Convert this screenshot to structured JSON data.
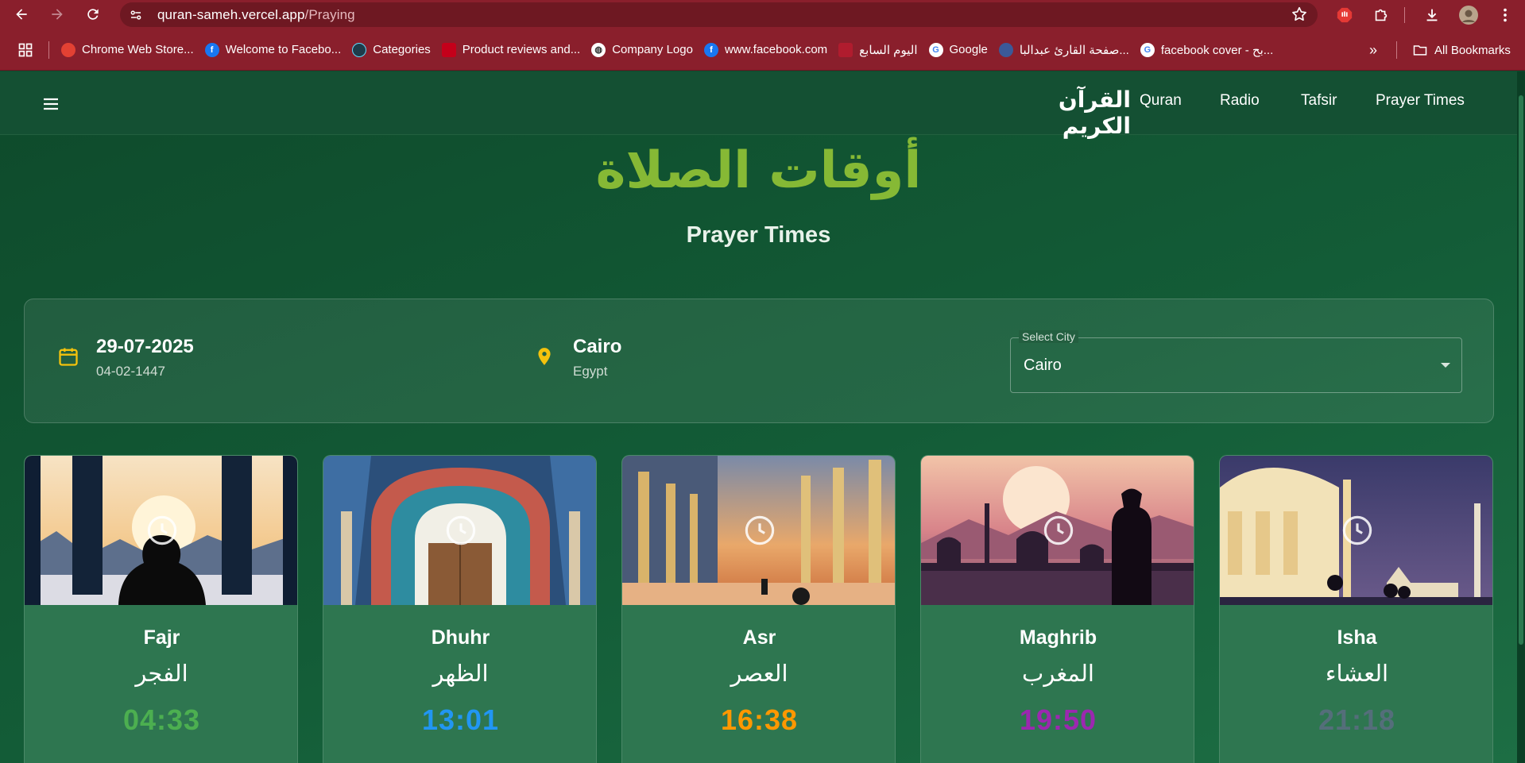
{
  "browser": {
    "url_host": "quran-sameh.vercel.app",
    "url_path": "/Praying",
    "bookmarks": [
      {
        "label": "Chrome Web Store...",
        "icon": "chrome-web-store-icon",
        "color": "#e34133"
      },
      {
        "label": "Welcome to Facebo...",
        "icon": "facebook-icon",
        "color": "#1877f2"
      },
      {
        "label": "Categories",
        "icon": "react-icon",
        "color": "#1e3b4a"
      },
      {
        "label": "Product reviews and...",
        "icon": "reviews-icon",
        "color": "#c4001a"
      },
      {
        "label": "Company Logo",
        "icon": "globe-icon",
        "color": "#ffffff"
      },
      {
        "label": "www.facebook.com",
        "icon": "facebook-icon",
        "color": "#1877f2"
      },
      {
        "label": "اليوم السابع",
        "icon": "youm7-icon",
        "color": "#b01c2e"
      },
      {
        "label": "Google",
        "icon": "google-icon",
        "color": "#ffffff"
      },
      {
        "label": "صفحة القارئ عبدالبا...",
        "icon": "reciter-page-icon",
        "color": "#3b5998"
      },
      {
        "label": "facebook cover - بح...",
        "icon": "google-icon",
        "color": "#ffffff"
      }
    ],
    "all_bookmarks_label": "All Bookmarks"
  },
  "header": {
    "brand": "القرآن الكريم",
    "nav": [
      "Quran",
      "Radio",
      "Tafsir",
      "Prayer Times"
    ]
  },
  "hero": {
    "title_ar": "أوقات الصلاة",
    "title_en": "Prayer Times"
  },
  "info": {
    "date_gregorian": "29-07-2025",
    "date_hijri": "04-02-1447",
    "city": "Cairo",
    "country": "Egypt",
    "select_label": "Select City",
    "select_value": "Cairo"
  },
  "prayers": [
    {
      "name_en": "Fajr",
      "name_ar": "الفجر",
      "time": "04:33",
      "color": "#4caf50"
    },
    {
      "name_en": "Dhuhr",
      "name_ar": "الظهر",
      "time": "13:01",
      "color": "#2196f3"
    },
    {
      "name_en": "Asr",
      "name_ar": "العصر",
      "time": "16:38",
      "color": "#ff9800"
    },
    {
      "name_en": "Maghrib",
      "name_ar": "المغرب",
      "time": "19:50",
      "color": "#9c27b0"
    },
    {
      "name_en": "Isha",
      "name_ar": "العشاء",
      "time": "21:18",
      "color": "#546e7a"
    }
  ]
}
